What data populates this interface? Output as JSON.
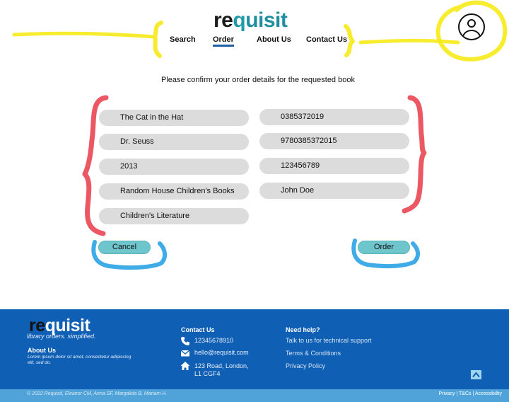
{
  "brand": {
    "re": "re",
    "q": "q",
    "rest": "uisit"
  },
  "nav": {
    "items": [
      {
        "label": "Search"
      },
      {
        "label": "Order"
      },
      {
        "label": "About Us"
      },
      {
        "label": "Contact Us"
      }
    ],
    "active": "Order"
  },
  "account": {
    "icon": "user-account-icon"
  },
  "main": {
    "prompt": "Please confirm your order details for the requested book",
    "left_fields": [
      "The Cat in the Hat",
      "Dr. Seuss",
      "2013",
      "Random House Children's Books",
      "Children's Literature"
    ],
    "right_fields": [
      "0385372019",
      "9780385372015",
      "123456789",
      "John Doe"
    ],
    "cancel_label": "Cancel",
    "order_label": "Order"
  },
  "footer": {
    "brand_re": "re",
    "brand_rest": "quisit",
    "tagline": "library orders. simplified.",
    "about_title": "About Us",
    "about_text": "Lorem ipsum dolor sit amet, consectetur adipiscing elit, sed do.",
    "contact_title": "Contact Us",
    "phone": "12345678910",
    "email": "hello@requisit.com",
    "address_line1": "123 Road, London,",
    "address_line2": "L1 CGF4",
    "help_title": "Need help?",
    "help_links": [
      "Talk to us for technical support",
      "Terms & Conditions",
      "Privacy Policy"
    ],
    "copyright": "© 2022 Requisit, Eleanor CM, Anna SF, Margalida B, Mariam H.",
    "legal_privacy": "Privacy",
    "legal_sep": "|",
    "legal_tcs": "T&Cs",
    "legal_accessibility": "Accessibility"
  },
  "colors": {
    "brand_teal": "#1f9aa8",
    "active_underline": "#1f5fa8",
    "button_teal": "#6ec6cc",
    "field_grey": "#dcdcdc",
    "footer_blue": "#0f5fb4",
    "bottom_bar": "#4fa3d8",
    "annotation_yellow": "#f7ea1c",
    "annotation_red": "#e8414f",
    "annotation_blue": "#2aa3e6"
  }
}
